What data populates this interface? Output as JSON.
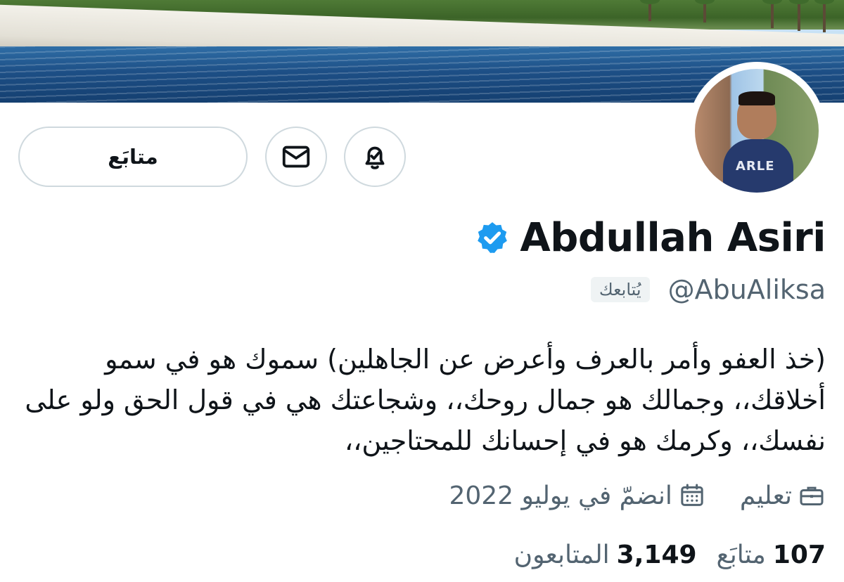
{
  "profile": {
    "display_name": "Abdullah Asiri",
    "handle": "@AbuAliksa",
    "follows_you_badge": "يُتابعك",
    "bio": "(خذ العفو وأمر بالعرف وأعرض عن الجاهلين) سموك هو في سمو أخلاقك،، وجمالك هو جمال روحك،، وشجاعتك هي في قول الحق ولو على نفسك،، وكرمك هو في إحسانك للمحتاجين،،"
  },
  "actions": {
    "follow_label": "متابَع"
  },
  "meta": {
    "category": "تعليم",
    "joined": "انضمّ في يوليو 2022"
  },
  "counts": {
    "following_value": "107",
    "following_label": "متابَع",
    "followers_value": "3,149",
    "followers_label": "المتابعون"
  },
  "icons": {
    "verified": "verified-badge-icon",
    "notifications": "bell-check-icon",
    "message": "envelope-icon",
    "category": "briefcase-icon",
    "joined": "calendar-icon"
  },
  "colors": {
    "verified_blue": "#1d9bf0",
    "text_primary": "#0f1419",
    "text_secondary": "#536471",
    "border": "#cfd9de"
  }
}
